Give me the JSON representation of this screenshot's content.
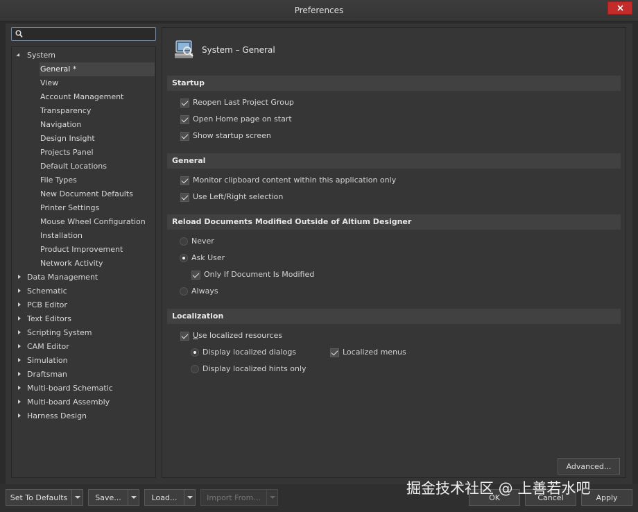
{
  "window": {
    "title": "Preferences",
    "close_icon": "close-icon"
  },
  "search": {
    "placeholder": "",
    "value": "",
    "icon": "search-icon"
  },
  "tree": {
    "root": {
      "label": "System",
      "expanded": true
    },
    "children": [
      "General *",
      "View",
      "Account Management",
      "Transparency",
      "Navigation",
      "Design Insight",
      "Projects Panel",
      "Default Locations",
      "File Types",
      "New Document Defaults",
      "Printer Settings",
      "Mouse Wheel Configuration",
      "Installation",
      "Product Improvement",
      "Network Activity"
    ],
    "selected_index": 0,
    "top_nodes": [
      "Data Management",
      "Schematic",
      "PCB Editor",
      "Text Editors",
      "Scripting System",
      "CAM Editor",
      "Simulation",
      "Draftsman",
      "Multi-board Schematic",
      "Multi-board Assembly",
      "Harness Design"
    ]
  },
  "page": {
    "title": "System – General",
    "icon": "system-preferences-icon"
  },
  "sections": {
    "startup": {
      "title": "Startup",
      "items": [
        {
          "label": "Reopen Last Project Group",
          "checked": true
        },
        {
          "label": "Open Home page on start",
          "checked": true
        },
        {
          "label": "Show startup screen",
          "checked": true
        }
      ]
    },
    "general": {
      "title": "General",
      "items": [
        {
          "label": "Monitor clipboard content within this application only",
          "checked": true
        },
        {
          "label": "Use Left/Right selection",
          "checked": true
        }
      ]
    },
    "reload": {
      "title": "Reload Documents Modified Outside of Altium Designer",
      "never": "Never",
      "ask_user": "Ask User",
      "only_if_modified": "Only If Document Is Modified",
      "always": "Always",
      "selected": "Ask User",
      "only_if_modified_checked": true
    },
    "localization": {
      "title": "Localization",
      "use_localized": "Use localized resources",
      "use_localized_checked": true,
      "display_dialogs": "Display localized dialogs",
      "display_hints": "Display localized hints only",
      "selected": "Display localized dialogs",
      "localized_menus": "Localized menus",
      "localized_menus_checked": true
    }
  },
  "buttons": {
    "advanced": "Advanced...",
    "set_defaults": "Set To Defaults",
    "save": "Save...",
    "load": "Load...",
    "import_from": "Import From...",
    "ok": "OK",
    "cancel": "Cancel",
    "apply": "Apply"
  },
  "watermark": "掘金技术社区 @ 上善若水吧"
}
